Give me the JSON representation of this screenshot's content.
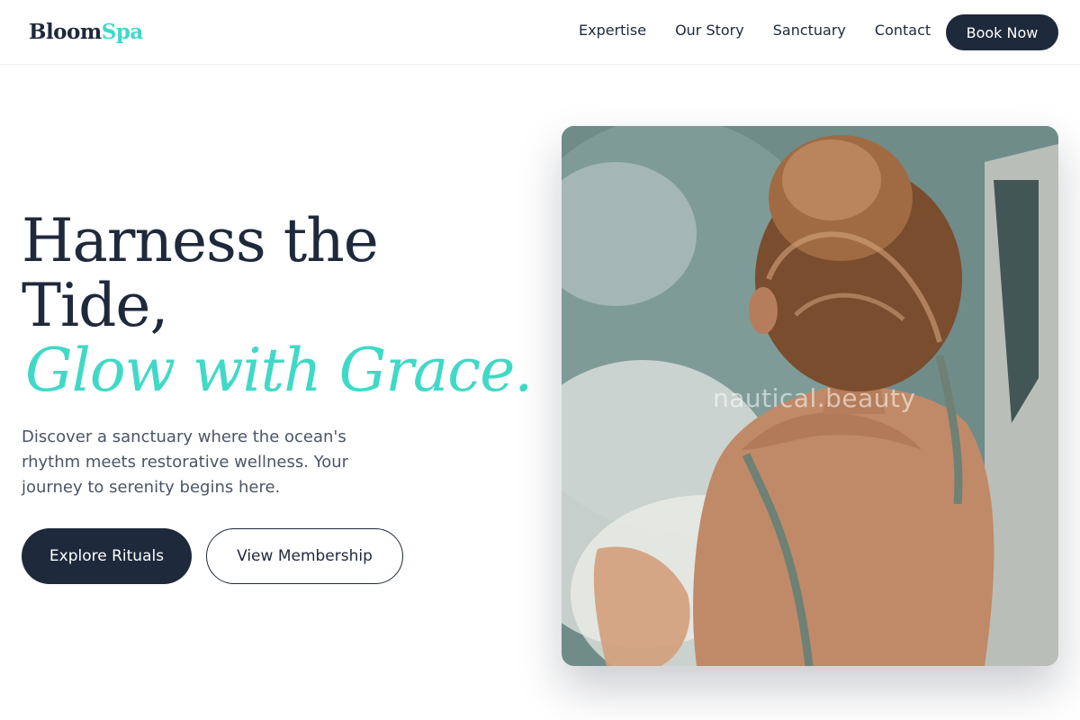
{
  "header": {
    "logo_part1": "Bloom",
    "logo_part2": "Spa",
    "nav": [
      "Expertise",
      "Our Story",
      "Sanctuary",
      "Contact"
    ],
    "cta_label": "Book Now"
  },
  "hero": {
    "title_line1": "Harness the",
    "title_line2": "Tide,",
    "title_accent": "Glow with Grace.",
    "description": "Discover a sanctuary where the ocean's rhythm meets restorative wellness. Your journey to serenity begins here.",
    "primary_button": "Explore Rituals",
    "secondary_button": "View Membership",
    "image_watermark": "nautical.beauty"
  },
  "colors": {
    "navy": "#1e293b",
    "accent_teal": "#40d9c7",
    "body_text": "#4b5566"
  },
  "image": {
    "subject": "woman with hair bun relaxing in a bubbling spa pool"
  }
}
